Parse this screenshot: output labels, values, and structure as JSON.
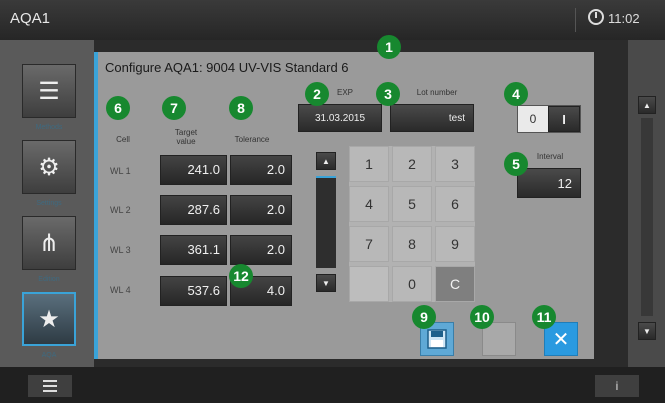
{
  "header": {
    "app_title": "AQA1",
    "time": "11:02",
    "clock_icon": "clock-icon"
  },
  "sidebar": {
    "items": [
      {
        "label": "Methods",
        "icon": "list-icon",
        "glyph": "☰"
      },
      {
        "label": "Settings",
        "icon": "gear-icon",
        "glyph": "⚙"
      },
      {
        "label": "Edition",
        "icon": "config-icon",
        "glyph": "⋔"
      },
      {
        "label": "AQA",
        "icon": "aqa-star-icon",
        "glyph": "★"
      }
    ]
  },
  "dialog": {
    "title": "Configure AQA1: 9004 UV-VIS Standard 6",
    "column_headers": {
      "cell": "Cell",
      "target_value": "Target value",
      "tolerance": "Tolerance"
    },
    "rows": [
      {
        "label": "WL 1",
        "target": "241.0",
        "tolerance": "2.0"
      },
      {
        "label": "WL 2",
        "target": "287.6",
        "tolerance": "2.0"
      },
      {
        "label": "WL 3",
        "target": "361.1",
        "tolerance": "2.0"
      },
      {
        "label": "WL 4",
        "target": "537.6",
        "tolerance": "4.0"
      }
    ],
    "exp_label": "EXP",
    "exp_value": "31.03.2015",
    "lot_label": "Lot number",
    "lot_value": "test",
    "toggle": {
      "off": "0",
      "on": "I"
    },
    "interval_label": "Interval",
    "interval_value": "12",
    "keypad": [
      "1",
      "2",
      "3",
      "4",
      "5",
      "6",
      "7",
      "8",
      "9",
      "",
      "0",
      "C"
    ],
    "buttons": {
      "save_icon": "save-icon",
      "blank": "",
      "close_icon": "close-icon",
      "close_glyph": "✕"
    }
  },
  "badges": [
    "1",
    "2",
    "3",
    "4",
    "5",
    "6",
    "7",
    "8",
    "9",
    "10",
    "11",
    "12"
  ],
  "footer": {
    "menu_icon": "menu-icon",
    "info_label": "i"
  },
  "colors": {
    "accent": "#3aa3d8",
    "badge": "#17882f",
    "dialog_bg": "#9a9a9a"
  }
}
